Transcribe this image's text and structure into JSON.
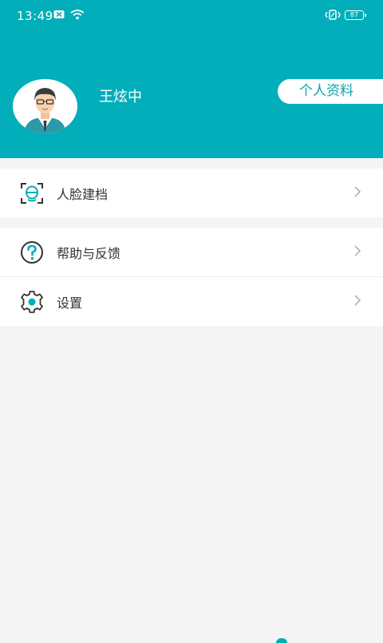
{
  "status_bar": {
    "time": "13:49",
    "battery": "87"
  },
  "profile": {
    "name": "王炫中",
    "button_label": "个人资料"
  },
  "menu": [
    {
      "label": "人脸建档",
      "icon": "face-scan-icon"
    },
    {
      "label": "帮助与反馈",
      "icon": "help-icon"
    },
    {
      "label": "设置",
      "icon": "settings-gear-icon"
    }
  ],
  "colors": {
    "brand": "#01aeba",
    "background": "#f4f4f4",
    "text": "#333333"
  }
}
